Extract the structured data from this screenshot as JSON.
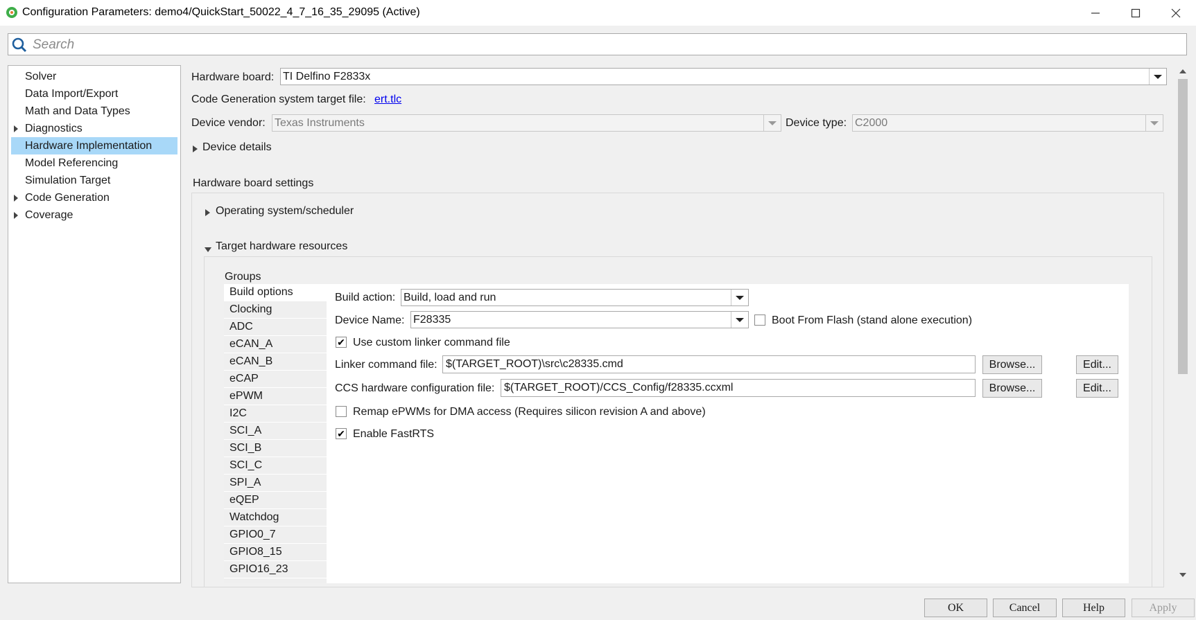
{
  "window": {
    "title": "Configuration Parameters: demo4/QuickStart_50022_4_7_16_35_29095 (Active)",
    "minimize_icon": "minimize-icon",
    "maximize_icon": "maximize-icon",
    "close_icon": "close-icon"
  },
  "search": {
    "placeholder": "Search"
  },
  "tree": {
    "items": [
      {
        "label": "Solver",
        "expandable": false,
        "selected": false
      },
      {
        "label": "Data Import/Export",
        "expandable": false,
        "selected": false
      },
      {
        "label": "Math and Data Types",
        "expandable": false,
        "selected": false
      },
      {
        "label": "Diagnostics",
        "expandable": true,
        "selected": false
      },
      {
        "label": "Hardware Implementation",
        "expandable": false,
        "selected": true
      },
      {
        "label": "Model Referencing",
        "expandable": false,
        "selected": false
      },
      {
        "label": "Simulation Target",
        "expandable": false,
        "selected": false
      },
      {
        "label": "Code Generation",
        "expandable": true,
        "selected": false
      },
      {
        "label": "Coverage",
        "expandable": true,
        "selected": false
      }
    ]
  },
  "hardware": {
    "board_label": "Hardware board:",
    "board_value": "TI Delfino F2833x",
    "codegen_label": "Code Generation system target file:",
    "codegen_link": "ert.tlc",
    "vendor_label": "Device vendor:",
    "vendor_value": "Texas Instruments",
    "type_label": "Device type:",
    "type_value": "C2000",
    "device_details": "Device details",
    "board_settings": "Hardware board settings",
    "os_scheduler": "Operating system/scheduler",
    "target_resources": "Target hardware resources",
    "groups_label": "Groups"
  },
  "groups": [
    {
      "label": "Build options",
      "selected": true
    },
    {
      "label": "Clocking",
      "selected": false
    },
    {
      "label": "ADC",
      "selected": false
    },
    {
      "label": "eCAN_A",
      "selected": false
    },
    {
      "label": "eCAN_B",
      "selected": false
    },
    {
      "label": "eCAP",
      "selected": false
    },
    {
      "label": "ePWM",
      "selected": false
    },
    {
      "label": "I2C",
      "selected": false
    },
    {
      "label": "SCI_A",
      "selected": false
    },
    {
      "label": "SCI_B",
      "selected": false
    },
    {
      "label": "SCI_C",
      "selected": false
    },
    {
      "label": "SPI_A",
      "selected": false
    },
    {
      "label": "eQEP",
      "selected": false
    },
    {
      "label": "Watchdog",
      "selected": false
    },
    {
      "label": "GPIO0_7",
      "selected": false
    },
    {
      "label": "GPIO8_15",
      "selected": false
    },
    {
      "label": "GPIO16_23",
      "selected": false
    }
  ],
  "build": {
    "action_label": "Build action:",
    "action_value": "Build, load and run",
    "device_name_label": "Device Name:",
    "device_name_value": "F28335",
    "boot_flash_label": "Boot From Flash (stand alone execution)",
    "boot_flash_checked": false,
    "custom_linker_label": "Use custom linker command file",
    "custom_linker_checked": true,
    "linker_label": "Linker command file:",
    "linker_value": "$(TARGET_ROOT)\\src\\c28335.cmd",
    "ccs_label": "CCS hardware configuration file:",
    "ccs_value": "$(TARGET_ROOT)/CCS_Config/f28335.ccxml",
    "browse_label": "Browse...",
    "edit_label": "Edit...",
    "remap_label": "Remap ePWMs for DMA access (Requires silicon revision A and above)",
    "remap_checked": false,
    "fastrts_label": "Enable FastRTS",
    "fastrts_checked": true
  },
  "buttons": {
    "ok": "OK",
    "cancel": "Cancel",
    "help": "Help",
    "apply": "Apply"
  }
}
